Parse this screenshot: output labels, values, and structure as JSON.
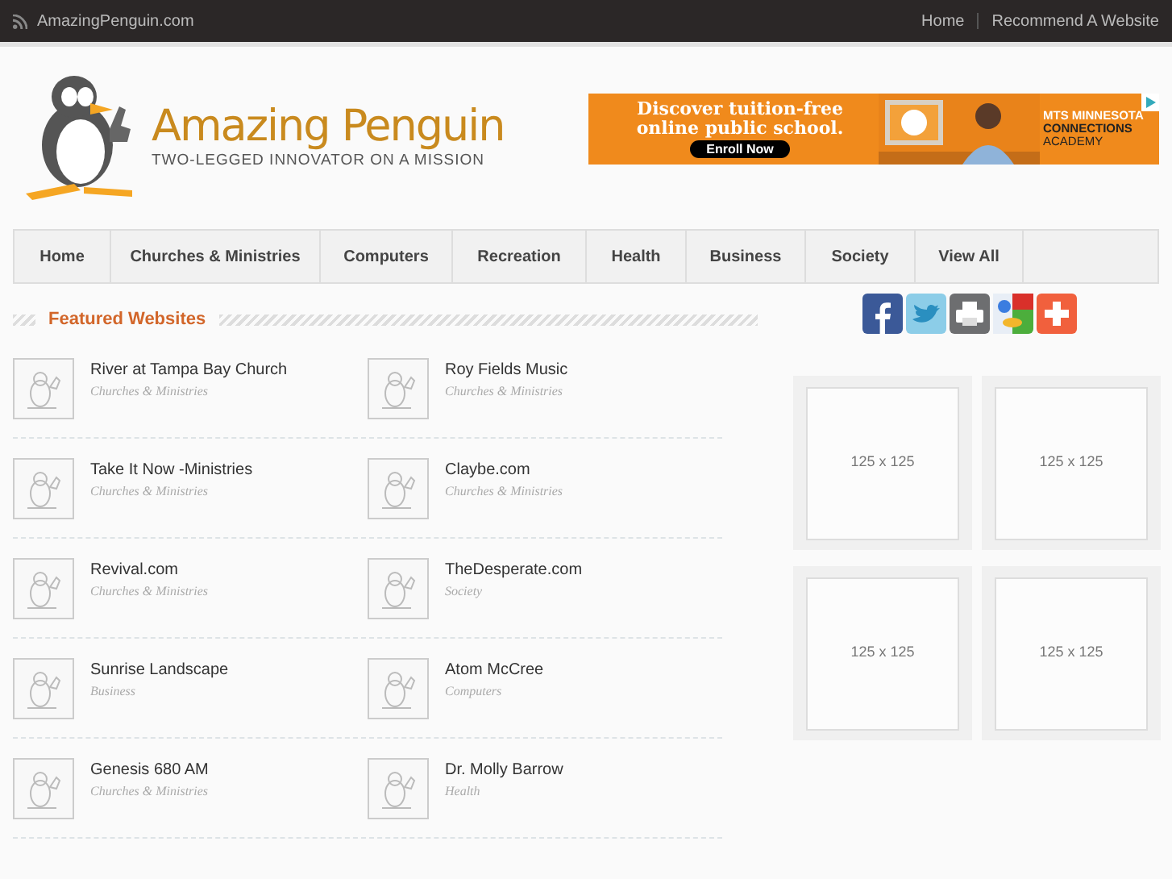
{
  "top_bar": {
    "site": "AmazingPenguin.com",
    "links": [
      "Home",
      "Recommend A Website"
    ]
  },
  "logo": {
    "title": "Amazing Penguin",
    "tagline": "TWO-LEGGED INNOVATOR ON A MISSION"
  },
  "ad_banner": {
    "headline": "Discover tuition-free online public school.",
    "button": "Enroll Now",
    "sponsor": [
      "MTS MINNESOTA",
      "CONNECTIONS",
      "ACADEMY"
    ]
  },
  "nav": [
    {
      "label": "Home",
      "selected": false
    },
    {
      "label": "Churches & Ministries",
      "selected": false
    },
    {
      "label": "Computers",
      "selected": false
    },
    {
      "label": "Recreation",
      "selected": false
    },
    {
      "label": "Health",
      "selected": false
    },
    {
      "label": "Business",
      "selected": false
    },
    {
      "label": "Society",
      "selected": false
    },
    {
      "label": "View All",
      "selected": false
    }
  ],
  "featured": {
    "title": "Featured Websites",
    "items": [
      {
        "name": "River at Tampa Bay Church",
        "category": "Churches & Ministries"
      },
      {
        "name": "Roy Fields Music",
        "category": "Churches & Ministries"
      },
      {
        "name": "Take It Now -Ministries",
        "category": "Churches & Ministries"
      },
      {
        "name": "Claybe.com",
        "category": "Churches & Ministries"
      },
      {
        "name": "Revival.com",
        "category": "Churches & Ministries"
      },
      {
        "name": "TheDesperate.com",
        "category": "Society"
      },
      {
        "name": "Sunrise Landscape",
        "category": "Business"
      },
      {
        "name": "Atom McCree",
        "category": "Computers"
      },
      {
        "name": "Genesis 680 AM",
        "category": "Churches & Ministries"
      },
      {
        "name": "Dr. Molly Barrow",
        "category": "Health"
      }
    ]
  },
  "social": [
    {
      "kind": "facebook"
    },
    {
      "kind": "twitter"
    },
    {
      "kind": "print"
    },
    {
      "kind": "google"
    },
    {
      "kind": "addthis"
    }
  ],
  "ad_slots": [
    "125 x 125",
    "125 x 125",
    "125 x 125",
    "125 x 125"
  ]
}
